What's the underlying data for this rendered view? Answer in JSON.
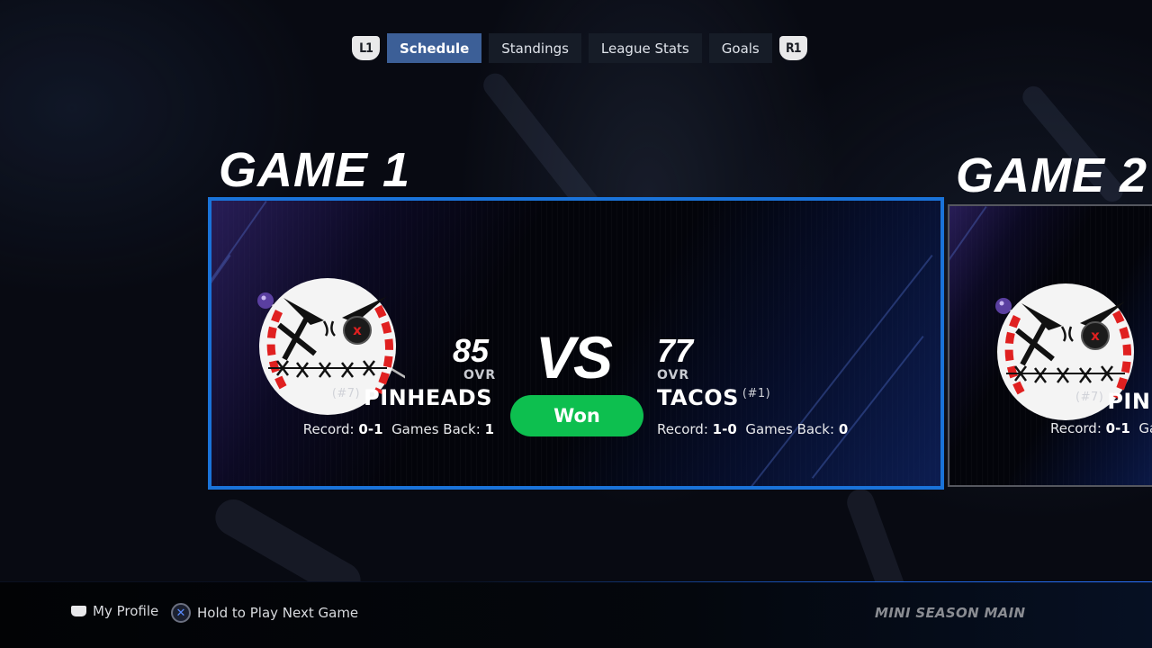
{
  "nav": {
    "left_bumper": "L1",
    "right_bumper": "R1",
    "tabs": [
      {
        "label": "Schedule",
        "active": true
      },
      {
        "label": "Standings",
        "active": false
      },
      {
        "label": "League Stats",
        "active": false
      },
      {
        "label": "Goals",
        "active": false
      }
    ]
  },
  "games": [
    {
      "title": "GAME 1",
      "selected": true,
      "home": {
        "name": "PINHEADS",
        "seed": "(#7)",
        "ovr": "85",
        "ovr_label": "OVR",
        "record_label": "Record:",
        "record": "0-1",
        "games_back_label": "Games Back:",
        "games_back": "1",
        "logo": "pinheads-baseball-logo"
      },
      "vs_label": "VS",
      "result": "Won",
      "away": {
        "name": "TACOS",
        "seed": "(#1)",
        "ovr": "77",
        "ovr_label": "OVR",
        "record_label": "Record:",
        "record": "1-0",
        "games_back_label": "Games Back:",
        "games_back": "0"
      }
    },
    {
      "title": "GAME 2",
      "selected": false,
      "home": {
        "name": "PINHEADS",
        "seed": "(#7)",
        "record_label": "Record:",
        "record": "0-1",
        "games_back_label": "Games Back:",
        "logo": "pinheads-baseball-logo"
      }
    }
  ],
  "footer": {
    "hints": [
      {
        "icon": "touchpad-icon",
        "label": "My Profile"
      },
      {
        "icon": "cross-button-icon",
        "label": "Hold to Play Next Game"
      }
    ],
    "screen_label": "MINI SEASON MAIN"
  },
  "colors": {
    "accent": "#1a73d9",
    "active_tab": "#3c5f97",
    "won": "#0dbf4f"
  }
}
